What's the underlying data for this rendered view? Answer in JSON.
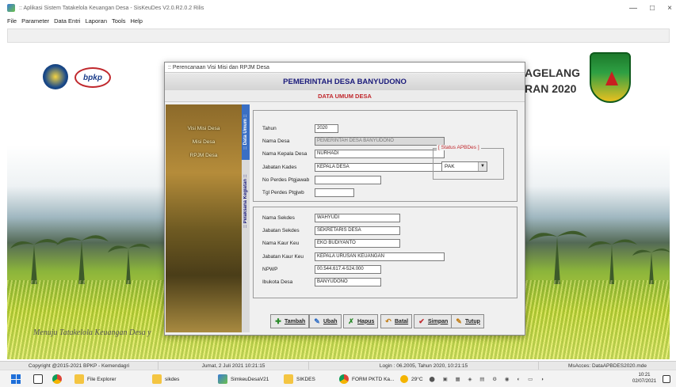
{
  "window": {
    "title": ":: Aplikasi Sistem Tatakelola Keuangan Desa - SisKeuDes V2.0.R2.0.2 Rilis",
    "controls": [
      "—",
      "□",
      "×"
    ]
  },
  "menu": [
    "File",
    "Parameter",
    "Data Entri",
    "Laporan",
    "Tools",
    "Help"
  ],
  "background": {
    "logo_bpkp": "bpkp",
    "header_right_1": "AGELANG",
    "header_right_2": "RAN 2020",
    "tagline": "Menuju Tatakelola Keuangan Desa y"
  },
  "dialog": {
    "title": ":: Perencanaan Visi Misi dan RPJM Desa",
    "header": "PEMERINTAH DESA BANYUDONO",
    "subheader": "DATA UMUM DESA",
    "side_menu": [
      "Visi Misi Desa",
      "Misi Desa",
      "RPJM Desa"
    ],
    "tabs": [
      ":: Data Umum ::",
      ":: Pelaksana Kegiatan ::"
    ],
    "fields_top": [
      {
        "label": "Tahun",
        "value": "2020"
      },
      {
        "label": "Nama Desa",
        "value": "PEMERINTAH DESA BANYUDONO"
      },
      {
        "label": "Nama Kepala Desa",
        "value": "NURHADI"
      },
      {
        "label": "Jabatan Kades",
        "value": "KEPALA DESA"
      },
      {
        "label": "No Perdes Ptgjawab",
        "value": ""
      },
      {
        "label": "Tgl Perdes Ptgjwb",
        "value": ""
      }
    ],
    "status_apbdes": {
      "legend": "[ Status APBDes ]",
      "value": "PAK"
    },
    "fields_bottom": [
      {
        "label": "Nama Sekdes",
        "value": "WAHYUDI"
      },
      {
        "label": "Jabatan Sekdes",
        "value": "SEKRETARIS DESA"
      },
      {
        "label": "Nama Kaur Keu",
        "value": "EKO BUDIYANTO"
      },
      {
        "label": "Jabatan Kaur Keu",
        "value": "KEPALA URUSAN KEUANGAN"
      },
      {
        "label": "NPWP",
        "value": "00.544.617.4-524.000"
      },
      {
        "label": "Ibukota Desa",
        "value": "BANYUDONO"
      }
    ],
    "buttons": [
      "Tambah",
      "Ubah",
      "Hapus",
      "Batal",
      "Simpan",
      "Tutup"
    ]
  },
  "statusbar": {
    "copyright": "Copyright @2015-2021 BPKP - Kemendagri",
    "datetime": "Jumat, 2 Juli 2021  10:21:15",
    "login": "Login : 06.2005,  Tahun 2020, 10:21:15",
    "db": "MsAcces: DataAPBDES2020.mde"
  },
  "taskbar": {
    "items": [
      "File Explorer",
      "sikdes",
      "SimkeuDesaV21",
      "SIKDES",
      "FORM PKTD Ka..."
    ],
    "temperature": "29°C",
    "time": "10:21",
    "date": "02/07/2021"
  }
}
